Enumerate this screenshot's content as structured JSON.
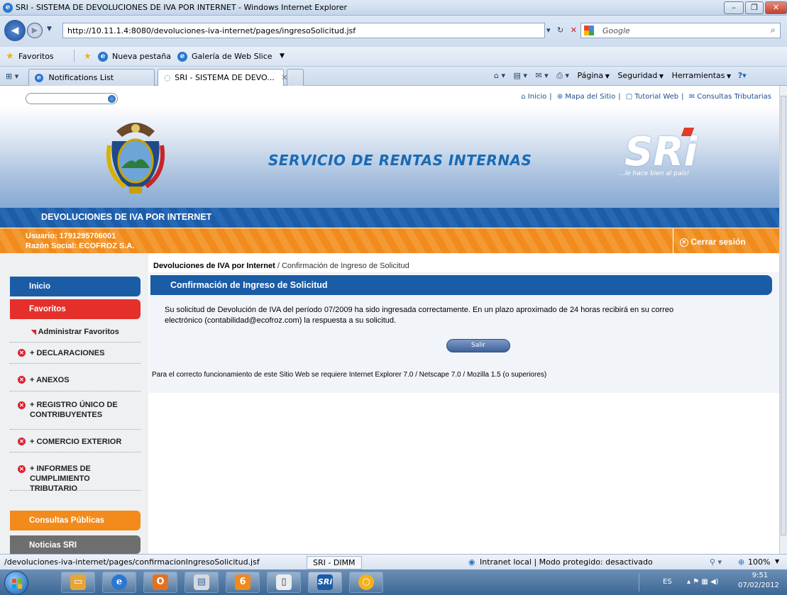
{
  "window": {
    "title": "SRI - SISTEMA DE DEVOLUCIONES DE IVA POR INTERNET - Windows Internet Explorer",
    "url": "http://10.11.1.4:8080/devoluciones-iva-internet/pages/ingresoSolicitud.jsf",
    "search_placeholder": "Google"
  },
  "favorites_bar": {
    "favoritos": "Favoritos",
    "new_tab": "Nueva pestaña",
    "web_slice": "Galería de Web Slice"
  },
  "tabs": [
    {
      "label": "Notifications List"
    },
    {
      "label": "SRI - SISTEMA DE DEVO..."
    }
  ],
  "command_bar": {
    "page": "Página",
    "security": "Seguridad",
    "tools": "Herramientas"
  },
  "site": {
    "top_links": [
      "Inicio",
      "Mapa del Sitio",
      "Tutorial Web",
      "Consultas Tributarias"
    ],
    "banner_title": "SERVICIO DE RENTAS INTERNAS",
    "logo_text": "SRi",
    "logo_slogan": "...le hace bien al país!",
    "section_title": "DEVOLUCIONES DE IVA POR INTERNET",
    "user_label": "Usuario: 1791295706001",
    "company_label": "Razón Social: ECOFROZ S.A.",
    "logout": "Cerrar sesión"
  },
  "menu": {
    "inicio": "Inicio",
    "favoritos": "Favoritos",
    "admin_favoritos": "Administrar Favoritos",
    "items": [
      "+ DECLARACIONES",
      "+ ANEXOS",
      "+ REGISTRO ÚNICO DE CONTRIBUYENTES",
      "+ COMERCIO EXTERIOR",
      "+ INFORMES DE CUMPLIMIENTO TRIBUTARIO"
    ],
    "consultas": "Consultas Públicas",
    "noticias": "Noticias SRI"
  },
  "content": {
    "breadcrumb_root": "Devoluciones de IVA por Internet",
    "breadcrumb_current": "/ Confirmación de Ingreso de Solicitud",
    "header": "Confirmación de Ingreso de Solicitud",
    "message_line1": "Su solicitud de Devolución de IVA del período 07/2009 ha sido ingresada correctamente. En un plazo aproximado de 24 horas recibirá en su correo",
    "message_line2": "electrónico (contabilidad@ecofroz.com) la respuesta a su solicitud.",
    "exit_button": "Salir",
    "requirements": "Para el correcto funcionamiento de este Sitio Web se requiere Internet Explorer 7.0 / Netscape 7.0 / Mozilla 1.5 (o superiores)"
  },
  "status_bar": {
    "url": "/devoluciones-iva-internet/pages/confirmacionIngresoSolicitud.jsf",
    "panel": "SRI - DIMM",
    "zone": "Intranet local | Modo protegido: desactivado",
    "zoom": "100%"
  },
  "taskbar": {
    "lang": "ES",
    "time": "9:51",
    "date": "07/02/2012"
  }
}
